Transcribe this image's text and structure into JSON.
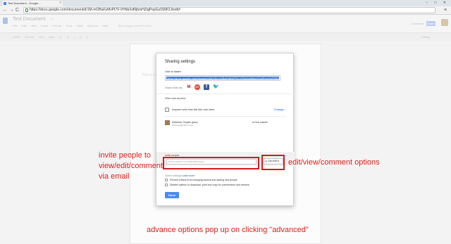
{
  "browser": {
    "tab_title": "Test Document - Google ...",
    "url": "https://docs.google.com/document/d/1M-mOBaFyMvPt70-VHhbXsf0jbmHZqjPepGy0SMOJ/edit#",
    "nav_back": "←",
    "nav_forward": "→",
    "nav_reload": "C",
    "menu": "≡",
    "window_controls": "– □ ✕"
  },
  "docs": {
    "title": "Test Document",
    "star": "☆",
    "menu_items": "File Edit View Insert Format Tools Table Add-ons Help",
    "last_edit": "All changes saved in Drive",
    "user_email": "",
    "comments_label": "Comments",
    "share_label": "Share",
    "format_tools": "100% Normal text Arial 11 B I U A",
    "editing_mode": "Editing",
    "page_text": "This is a"
  },
  "dialog": {
    "title": "Sharing settings",
    "link_label": "Link to share",
    "link_value": "https://docs.google.com/document/d/1M-mOBaFyMvPt70-VHhbXsf0jbmHZqjPepGy0SMOJ/edit?usp=sharing",
    "share_via_label": "Share link via:",
    "who_has_access": "Who has access",
    "access_row_text": "Anyone who has the link can view",
    "change_link": "Change...",
    "owner_name": "Abhinav Gupta (you)",
    "owner_email": "abhinavg@yahoo.com",
    "owner_role": "is the owner",
    "invite_label": "Invite people:",
    "invite_placeholder": "Enter names or email addresses...",
    "permission_value": "Can edit",
    "owner_settings": "Owner settings",
    "learn_more": "Learn more",
    "option_1": "Prevent editors from changing access and adding new people",
    "option_2": "Disable options to download, print and copy for commenters and viewers",
    "done_label": "Done"
  },
  "annotations": {
    "invite_note_1": "invite people to",
    "invite_note_2": "view/edit/comment",
    "invite_note_3": "via email",
    "options_note": "edit/view/comment options",
    "advanced_note": "advance options pop up on clicking \"advanced\"",
    "color": "#e0201c"
  }
}
